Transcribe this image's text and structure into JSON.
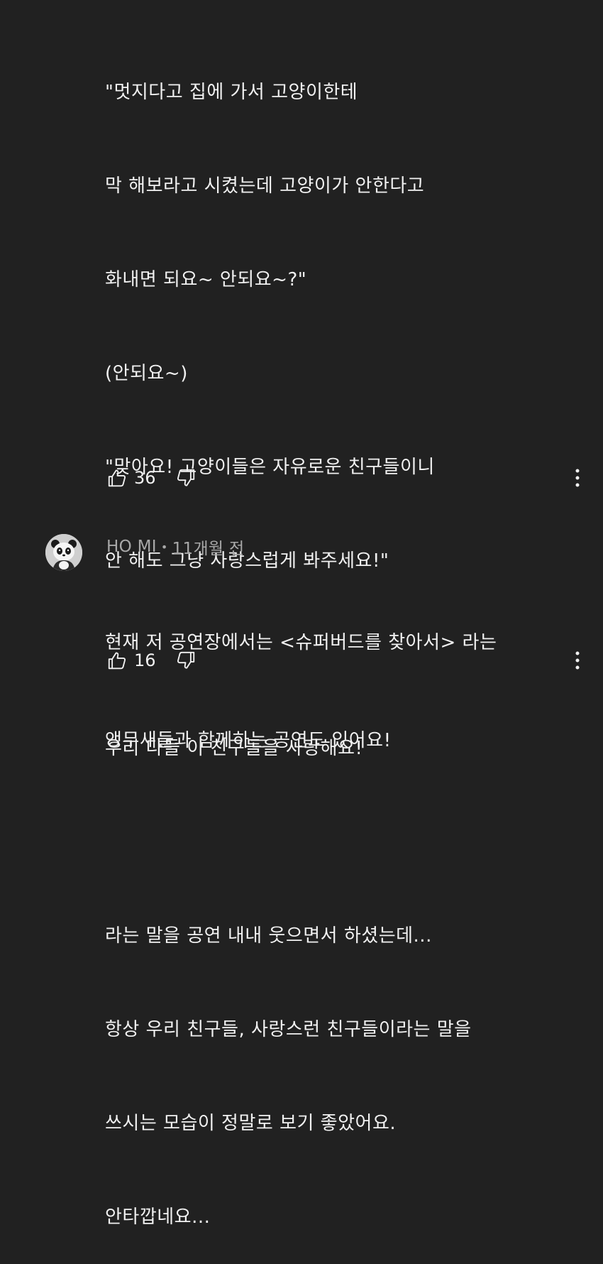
{
  "comment1": {
    "lines": [
      "\"멋지다고 집에 가서 고양이한테",
      "막 해보라고 시켰는데 고양이가 안한다고",
      "화내면 되요~ 안되요~?\"",
      "(안되요~)",
      "\"맞아요! 고양이들은 자유로운 친구들이니",
      "안 해도 그냥 사랑스럽게 봐주세요!\"",
      "",
      "우리 다들 이 친구들을 사랑해요!",
      "",
      "라는 말을 공연 내내 웃으면서 하셨는데...",
      "항상 우리 친구들, 사랑스런 친구들이라는 말을",
      "쓰시는 모습이 정말로 보기 좋았어요.",
      "안타깝네요..."
    ],
    "like_count": "36",
    "icons": {
      "like": "thumbs-up-icon",
      "dislike": "thumbs-down-icon",
      "more": "more-vertical-icon"
    }
  },
  "comment2": {
    "author": "HO MI",
    "separator": "•",
    "time": "11개월 전",
    "text_lines": [
      "현재 저 공연장에서는 <슈퍼버드를 찾아서> 라는",
      "앵무새들과 함께하는 공연도 있어요!"
    ],
    "like_count": "16",
    "avatar_icon": "panda-avatar"
  },
  "colors": {
    "background": "#212121",
    "text_primary": "#f1f1f1",
    "text_secondary": "#a8a8a8"
  }
}
